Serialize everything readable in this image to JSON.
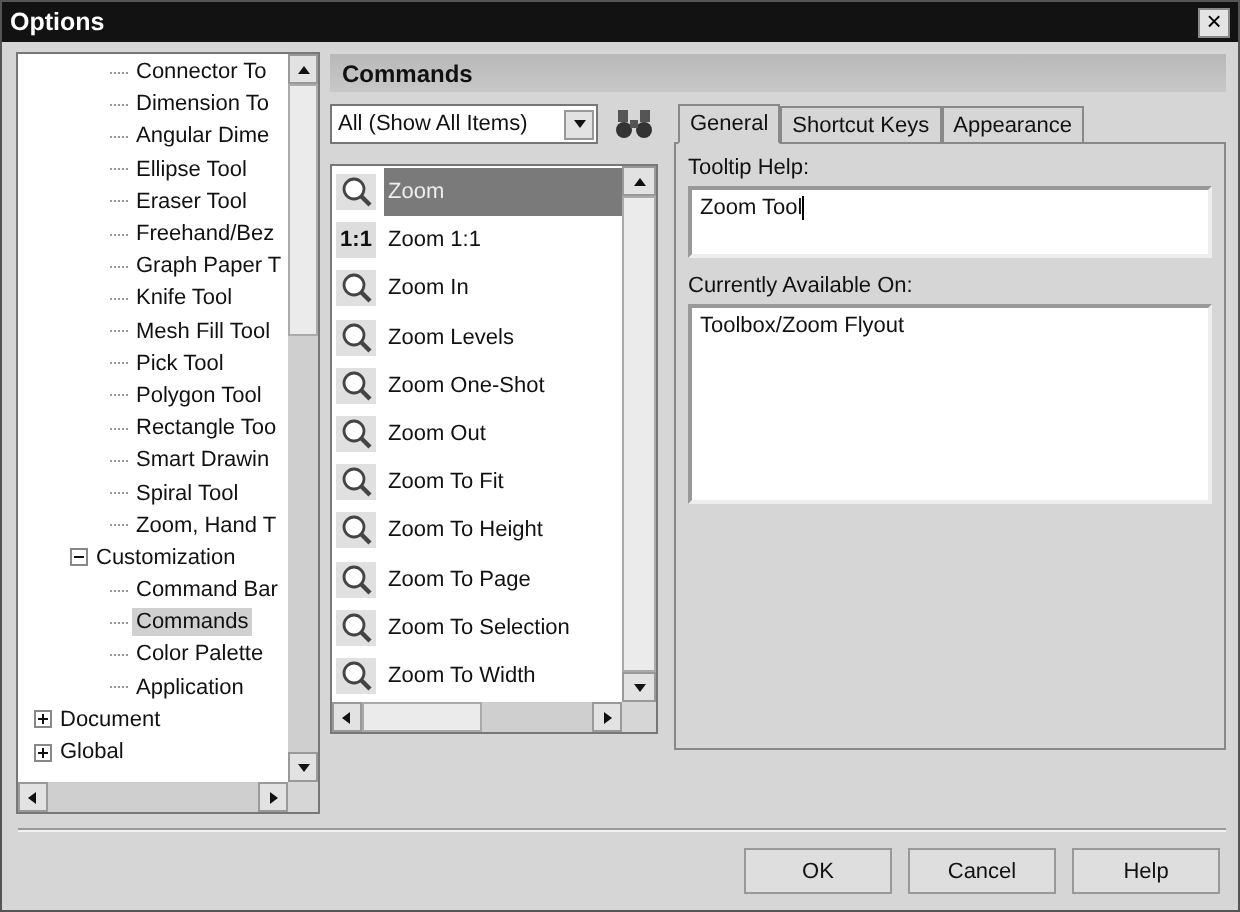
{
  "window": {
    "title": "Options",
    "close": "×"
  },
  "tree": {
    "items": [
      {
        "children": [
          {
            "children": [
              {
                "label": "Connector To",
                "selected": false
              },
              {
                "label": "Dimension To",
                "selected": false
              },
              {
                "label": "Angular Dime",
                "selected": false
              },
              {
                "label": "Ellipse Tool",
                "selected": false
              },
              {
                "label": "Eraser Tool",
                "selected": false
              },
              {
                "label": "Freehand/Bez",
                "selected": false
              },
              {
                "label": "Graph Paper T",
                "selected": false
              },
              {
                "label": "Knife Tool",
                "selected": false
              },
              {
                "label": "Mesh Fill Tool",
                "selected": false
              },
              {
                "label": "Pick Tool",
                "selected": false
              },
              {
                "label": "Polygon Tool",
                "selected": false
              },
              {
                "label": "Rectangle Too",
                "selected": false
              },
              {
                "label": "Smart Drawin",
                "selected": false
              },
              {
                "label": "Spiral Tool",
                "selected": false
              },
              {
                "label": "Zoom, Hand T",
                "selected": false
              }
            ]
          },
          {
            "label": "Customization",
            "expanded": true,
            "selected": false,
            "children": [
              {
                "label": "Command Bar",
                "selected": false
              },
              {
                "label": "Commands",
                "selected": true
              },
              {
                "label": "Color Palette",
                "selected": false
              },
              {
                "label": "Application",
                "selected": false
              }
            ]
          }
        ]
      },
      {
        "label": "Document",
        "expanded": false,
        "selected": false
      },
      {
        "label": "Global",
        "expanded": false,
        "selected": false
      }
    ]
  },
  "commands": {
    "title": "Commands",
    "filter": "All (Show All Items)",
    "items": [
      {
        "label": "Zoom",
        "selected": true
      },
      {
        "label": "Zoom 1:1",
        "selected": false,
        "badge": "1:1"
      },
      {
        "label": "Zoom In",
        "selected": false
      },
      {
        "label": "Zoom Levels",
        "selected": false
      },
      {
        "label": "Zoom One-Shot",
        "selected": false
      },
      {
        "label": "Zoom Out",
        "selected": false
      },
      {
        "label": "Zoom To Fit",
        "selected": false
      },
      {
        "label": "Zoom To Height",
        "selected": false
      },
      {
        "label": "Zoom To Page",
        "selected": false
      },
      {
        "label": "Zoom To Selection",
        "selected": false
      },
      {
        "label": "Zoom To Width",
        "selected": false
      }
    ]
  },
  "tabs": [
    {
      "label": "General",
      "selected": true
    },
    {
      "label": "Shortcut Keys",
      "selected": false
    },
    {
      "label": "Appearance",
      "selected": false
    }
  ],
  "general": {
    "tooltip_label": "Tooltip Help:",
    "tooltip_value": "Zoom Tool",
    "available_label": "Currently Available On:",
    "available_value": "Toolbox/Zoom Flyout"
  },
  "buttons": [
    "OK",
    "Cancel",
    "Help"
  ]
}
